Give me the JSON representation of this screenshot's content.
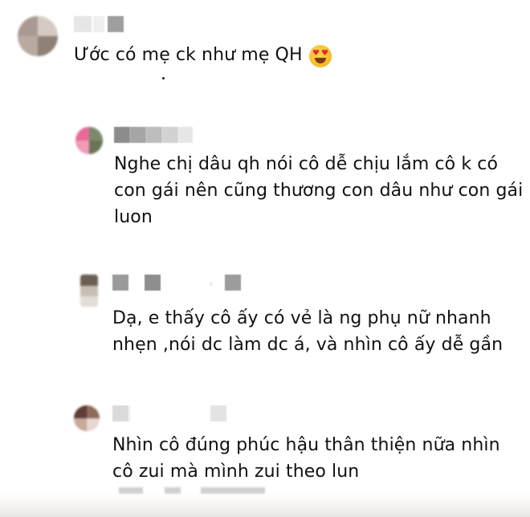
{
  "comments": [
    {
      "text_lines": [
        "Ước có mẹ ck như mẹ QH"
      ],
      "emoji": "heart-eyes-emoji"
    },
    {
      "text_lines": [
        "Nghe chị dâu qh nói cô dễ chịu lắm cô k có",
        "con gái nên cũng thương con dâu như con gái",
        "luon"
      ]
    },
    {
      "text_lines": [
        "Dạ, e thấy cô ấy có vẻ là ng phụ nữ nhanh",
        "nhẹn ,nói dc làm dc á, và nhìn cô ấy dễ gần"
      ]
    },
    {
      "text_lines": [
        "Nhìn cô đúng phúc hậu thân thiện nữa nhìn",
        "cô zui mà mình zui theo lun"
      ]
    }
  ],
  "colors": {
    "text": "#111111",
    "redaction": "#b8b8b8",
    "emoji_face": "#f7b924",
    "emoji_heart": "#e8233a"
  }
}
